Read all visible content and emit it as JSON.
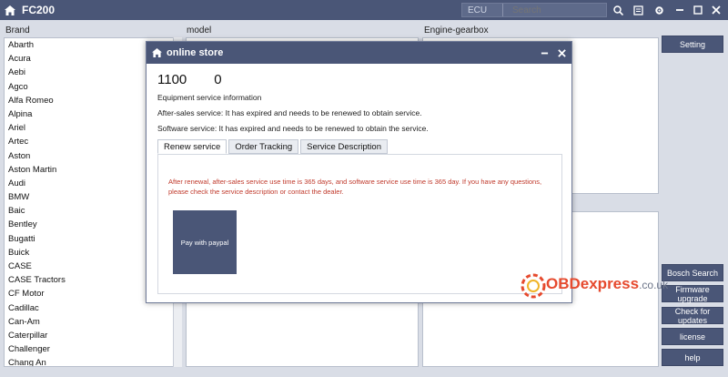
{
  "app": {
    "title": "FC200"
  },
  "search": {
    "scope": "ECU",
    "placeholder": "Search"
  },
  "columns": {
    "brand": "Brand",
    "model": "model",
    "engine": "Engine-gearbox"
  },
  "brands": [
    "Abarth",
    "Acura",
    "Aebi",
    "Agco",
    "Alfa Romeo",
    "Alpina",
    "Ariel",
    "Artec",
    "Aston",
    "Aston Martin",
    "Audi",
    "BMW",
    "Baic",
    "Bentley",
    "Bugatti",
    "Buick",
    "CASE",
    "CASE Tractors",
    "CF Motor",
    "Cadillac",
    "Can-Am",
    "Caterpillar",
    "Challenger",
    "Chang An"
  ],
  "side_buttons": {
    "setting": "Setting",
    "bosch_search": "Bosch Search",
    "firmware_upgrade": "Firmware upgrade",
    "check_updates": "Check for updates",
    "license": "license",
    "help": "help"
  },
  "dialog": {
    "title": "online store",
    "device_id_prefix": "1100",
    "device_id_suffix": "0",
    "equipment_info": "Equipment service information",
    "after_sales": "After-sales service: It has expired and needs to be renewed to obtain service.",
    "software": "Software service: It has expired and needs to be renewed to obtain the service.",
    "tabs": [
      "Renew service",
      "Order Tracking",
      "Service Description"
    ],
    "notice": "After renewal, after-sales service use time is 365 days, and software service use time is 365 day. If you have any questions, please check the service description or contact the dealer.",
    "pay_button": "Pay with paypal"
  },
  "watermark": {
    "brand": "OBDexpress",
    "domain": ".co.uk"
  },
  "colors": {
    "primary": "#4a5677",
    "notice": "#c0392b",
    "accent": "#e64a2e"
  }
}
